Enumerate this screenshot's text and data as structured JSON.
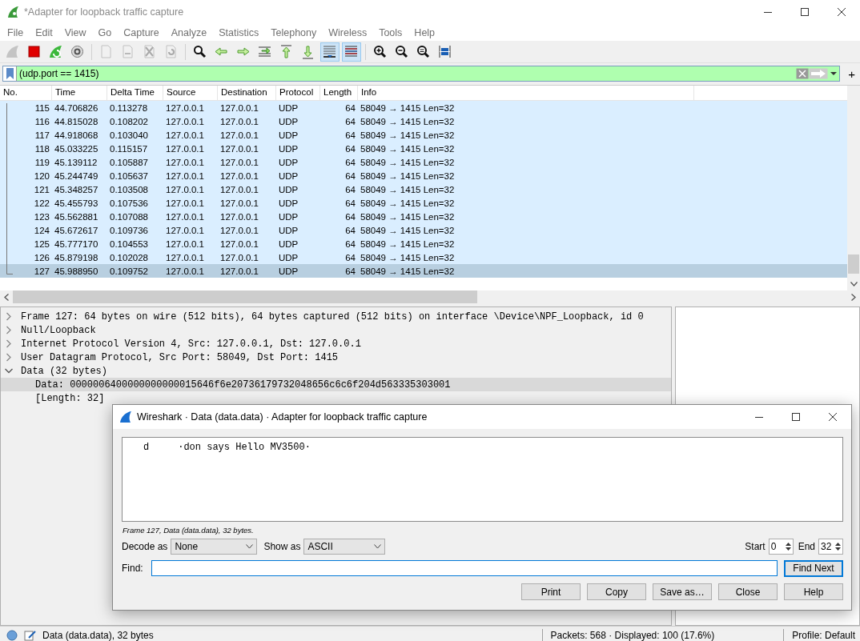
{
  "window": {
    "title": "*Adapter for loopback traffic capture"
  },
  "menu": [
    "File",
    "Edit",
    "View",
    "Go",
    "Capture",
    "Analyze",
    "Statistics",
    "Telephony",
    "Wireless",
    "Tools",
    "Help"
  ],
  "toolbar": [
    [
      {
        "disabled": true,
        "pressed": false
      },
      {
        "disabled": false,
        "pressed": false
      },
      {
        "disabled": false,
        "pressed": false
      },
      {
        "disabled": false,
        "pressed": false
      }
    ],
    [
      {
        "disabled": true,
        "pressed": false
      },
      {
        "disabled": true,
        "pressed": false
      },
      {
        "disabled": true,
        "pressed": false
      },
      {
        "disabled": true,
        "pressed": false
      }
    ],
    [
      {
        "disabled": false,
        "pressed": false
      },
      {
        "disabled": false,
        "pressed": false
      },
      {
        "disabled": false,
        "pressed": false
      },
      {
        "disabled": false,
        "pressed": false
      },
      {
        "disabled": false,
        "pressed": false
      },
      {
        "disabled": false,
        "pressed": false
      },
      {
        "disabled": false,
        "pressed": true
      },
      {
        "disabled": false,
        "pressed": true
      }
    ],
    [
      {
        "disabled": false,
        "pressed": false
      },
      {
        "disabled": false,
        "pressed": false
      },
      {
        "disabled": false,
        "pressed": false
      },
      {
        "disabled": false,
        "pressed": false
      }
    ]
  ],
  "filter": {
    "value": "(udp.port == 1415)",
    "valid": true,
    "add_button": "+"
  },
  "packet_list": {
    "columns": [
      "No.",
      "Time",
      "Delta Time",
      "Source",
      "Destination",
      "Protocol",
      "Length",
      "Info"
    ],
    "rows": [
      {
        "cells": [
          "115",
          "44.706826",
          "0.113278",
          "127.0.0.1",
          "127.0.0.1",
          "UDP",
          "64",
          "58049 → 1415 Len=32"
        ],
        "selected": false
      },
      {
        "cells": [
          "116",
          "44.815028",
          "0.108202",
          "127.0.0.1",
          "127.0.0.1",
          "UDP",
          "64",
          "58049 → 1415 Len=32"
        ],
        "selected": false
      },
      {
        "cells": [
          "117",
          "44.918068",
          "0.103040",
          "127.0.0.1",
          "127.0.0.1",
          "UDP",
          "64",
          "58049 → 1415 Len=32"
        ],
        "selected": false
      },
      {
        "cells": [
          "118",
          "45.033225",
          "0.115157",
          "127.0.0.1",
          "127.0.0.1",
          "UDP",
          "64",
          "58049 → 1415 Len=32"
        ],
        "selected": false
      },
      {
        "cells": [
          "119",
          "45.139112",
          "0.105887",
          "127.0.0.1",
          "127.0.0.1",
          "UDP",
          "64",
          "58049 → 1415 Len=32"
        ],
        "selected": false
      },
      {
        "cells": [
          "120",
          "45.244749",
          "0.105637",
          "127.0.0.1",
          "127.0.0.1",
          "UDP",
          "64",
          "58049 → 1415 Len=32"
        ],
        "selected": false
      },
      {
        "cells": [
          "121",
          "45.348257",
          "0.103508",
          "127.0.0.1",
          "127.0.0.1",
          "UDP",
          "64",
          "58049 → 1415 Len=32"
        ],
        "selected": false
      },
      {
        "cells": [
          "122",
          "45.455793",
          "0.107536",
          "127.0.0.1",
          "127.0.0.1",
          "UDP",
          "64",
          "58049 → 1415 Len=32"
        ],
        "selected": false
      },
      {
        "cells": [
          "123",
          "45.562881",
          "0.107088",
          "127.0.0.1",
          "127.0.0.1",
          "UDP",
          "64",
          "58049 → 1415 Len=32"
        ],
        "selected": false
      },
      {
        "cells": [
          "124",
          "45.672617",
          "0.109736",
          "127.0.0.1",
          "127.0.0.1",
          "UDP",
          "64",
          "58049 → 1415 Len=32"
        ],
        "selected": false
      },
      {
        "cells": [
          "125",
          "45.777170",
          "0.104553",
          "127.0.0.1",
          "127.0.0.1",
          "UDP",
          "64",
          "58049 → 1415 Len=32"
        ],
        "selected": false
      },
      {
        "cells": [
          "126",
          "45.879198",
          "0.102028",
          "127.0.0.1",
          "127.0.0.1",
          "UDP",
          "64",
          "58049 → 1415 Len=32"
        ],
        "selected": false
      },
      {
        "cells": [
          "127",
          "45.988950",
          "0.109752",
          "127.0.0.1",
          "127.0.0.1",
          "UDP",
          "64",
          "58049 → 1415 Len=32"
        ],
        "selected": true
      }
    ]
  },
  "details": {
    "items": [
      {
        "text": "Frame 127: 64 bytes on wire (512 bits), 64 bytes captured (512 bits) on interface \\Device\\NPF_Loopback, id 0",
        "expanded": false,
        "selected": false
      },
      {
        "text": "Null/Loopback",
        "expanded": false,
        "selected": false
      },
      {
        "text": "Internet Protocol Version 4, Src: 127.0.0.1, Dst: 127.0.0.1",
        "expanded": false,
        "selected": false
      },
      {
        "text": "User Datagram Protocol, Src Port: 58049, Dst Port: 1415",
        "expanded": false,
        "selected": false
      },
      {
        "text": "Data (32 bytes)",
        "expanded": true,
        "selected": false,
        "children": [
          {
            "text": "Data: 0000006400000000000015646f6e20736179732048656c6c6f204d563335303001",
            "selected": true
          },
          {
            "text": "[Length: 32]",
            "selected": false
          }
        ]
      }
    ]
  },
  "dialog": {
    "title": "Wireshark · Data (data.data) · Adapter for loopback traffic capture",
    "content": "d     ·don says Hello MV3500·",
    "caption": "Frame 127, Data (data.data), 32 bytes.",
    "decode_label": "Decode as",
    "decode_value": "None",
    "show_label": "Show as",
    "show_value": "ASCII",
    "start_label": "Start",
    "start_value": "0",
    "end_label": "End",
    "end_value": "32",
    "find_label": "Find:",
    "find_button": "Find Next",
    "buttons": [
      "Print",
      "Copy",
      "Save as…",
      "Close",
      "Help"
    ]
  },
  "status_bar": {
    "info": "Data (data.data), 32 bytes",
    "packets": "Packets: 568 · Displayed: 100 (17.6%)",
    "profile": "Profile: Default"
  }
}
